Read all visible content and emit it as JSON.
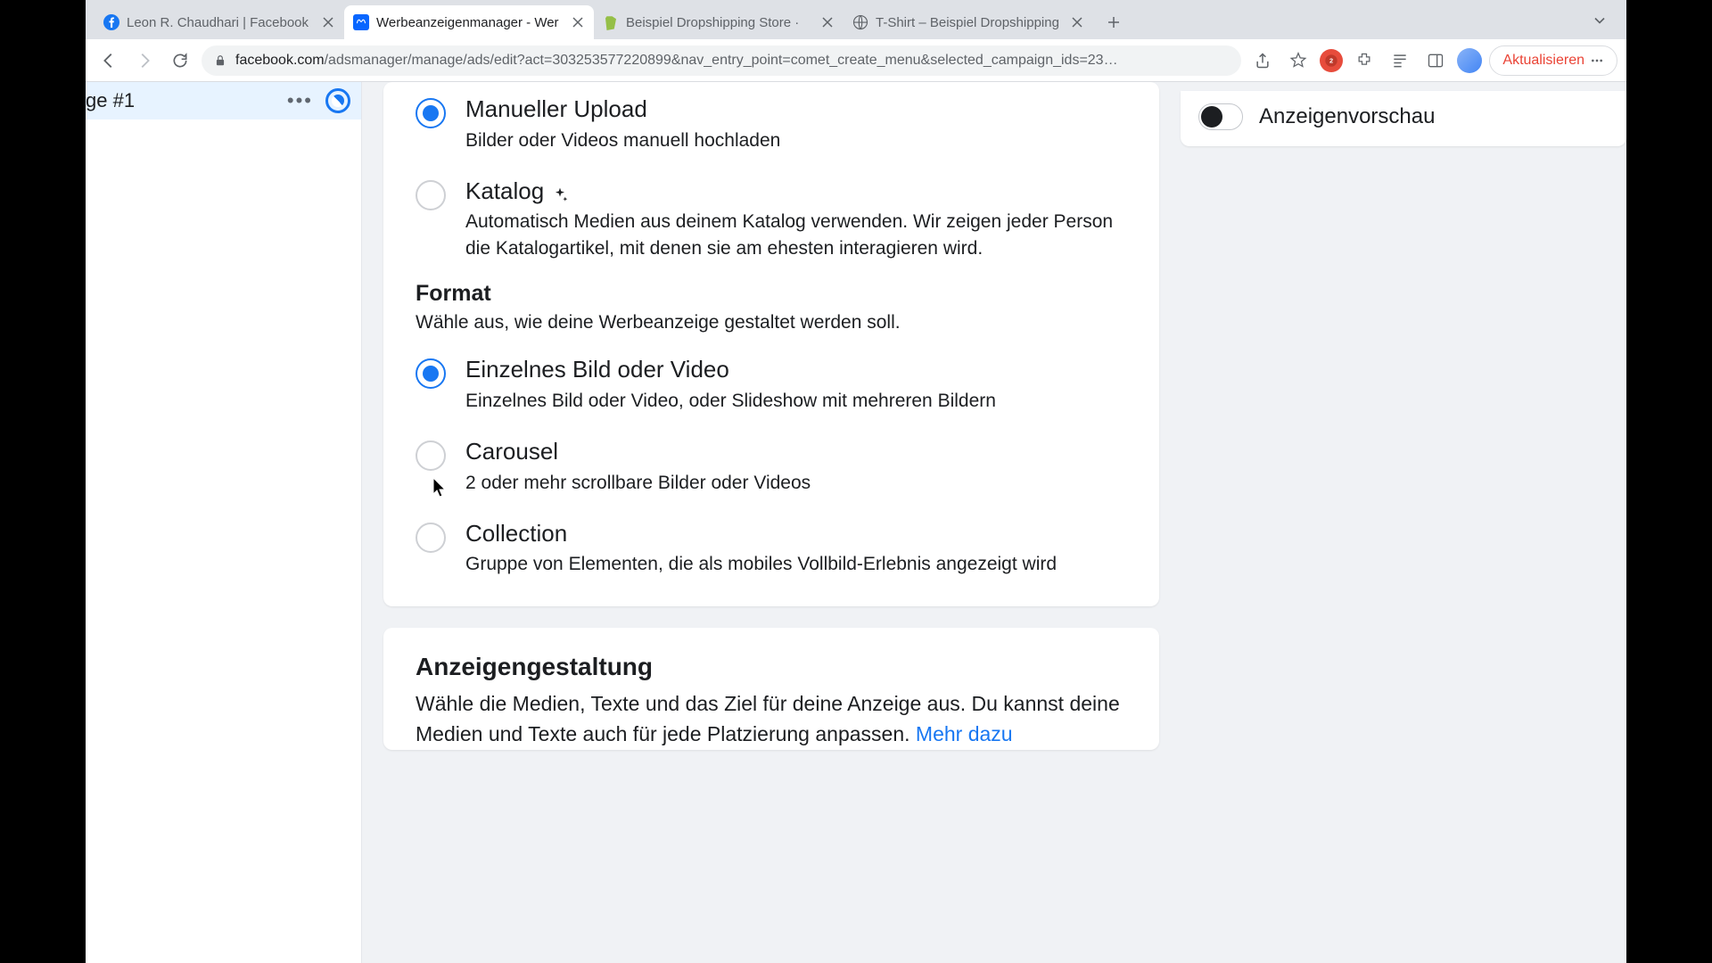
{
  "tabs": [
    {
      "title": "Leon R. Chaudhari | Facebook",
      "favicon": "facebook"
    },
    {
      "title": "Werbeanzeigenmanager - Wer",
      "favicon": "meta",
      "active": true
    },
    {
      "title": "Beispiel Dropshipping Store · ",
      "favicon": "shopify"
    },
    {
      "title": "T-Shirt – Beispiel Dropshipping",
      "favicon": "globe"
    }
  ],
  "url": {
    "host": "facebook.com",
    "path": "/adsmanager/manage/ads/edit?act=303253577220899&nav_entry_point=comet_create_menu&selected_campaign_ids=23…"
  },
  "update_button": "Aktualisieren",
  "sidebar": {
    "item_label": "ge #1"
  },
  "source": {
    "options": [
      {
        "title": "Manueller Upload",
        "desc": "Bilder oder Videos manuell hochladen",
        "selected": true
      },
      {
        "title": "Katalog",
        "desc": "Automatisch Medien aus deinem Katalog verwenden. Wir zeigen jeder Person die Katalogartikel, mit denen sie am ehesten interagieren wird.",
        "sparkle": true
      }
    ]
  },
  "format": {
    "title": "Format",
    "subtitle": "Wähle aus, wie deine Werbeanzeige gestaltet werden soll.",
    "options": [
      {
        "title": "Einzelnes Bild oder Video",
        "desc": "Einzelnes Bild oder Video, oder Slideshow mit mehreren Bildern",
        "selected": true
      },
      {
        "title": "Carousel",
        "desc": "2 oder mehr scrollbare Bilder oder Videos"
      },
      {
        "title": "Collection",
        "desc": "Gruppe von Elementen, die als mobiles Vollbild-Erlebnis angezeigt wird"
      }
    ]
  },
  "creative": {
    "title": "Anzeigengestaltung",
    "desc": "Wähle die Medien, Texte und das Ziel für deine Anzeige aus. Du kannst deine Medien und Texte auch für jede Platzierung anpassen. ",
    "link": "Mehr dazu"
  },
  "preview": {
    "label": "Anzeigenvorschau"
  }
}
